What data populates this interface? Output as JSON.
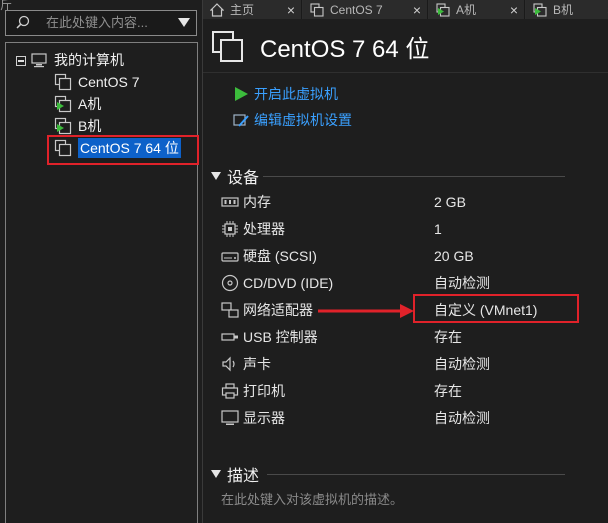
{
  "left_stub_text": "斤",
  "search": {
    "placeholder": "在此处键入内容...",
    "icon": "search-icon",
    "dropdown_icon": "triangle-down-icon"
  },
  "tree": {
    "root": {
      "label": "我的计算机",
      "icon": "computer-icon",
      "expanded": true
    },
    "items": [
      {
        "label": "CentOS 7",
        "icon": "vm-icon"
      },
      {
        "label": "A机",
        "icon": "vm-running-icon"
      },
      {
        "label": "B机",
        "icon": "vm-running-icon"
      },
      {
        "label": "CentOS 7 64 位",
        "icon": "vm-icon",
        "selected": true
      }
    ]
  },
  "tabs": [
    {
      "label": "主页",
      "icon": "home-icon",
      "close": "×"
    },
    {
      "label": "CentOS 7",
      "icon": "vm-icon",
      "close": "×"
    },
    {
      "label": "A机",
      "icon": "vm-running-icon",
      "close": "×"
    },
    {
      "label": "B机",
      "icon": "vm-running-icon",
      "close": "×"
    }
  ],
  "vm": {
    "title": "CentOS 7 64 位",
    "actions": [
      {
        "label": "开启此虚拟机",
        "icon": "play-icon"
      },
      {
        "label": "编辑虚拟机设置",
        "icon": "edit-settings-icon"
      }
    ]
  },
  "devices": {
    "heading": "设备",
    "rows": [
      {
        "name": "内存",
        "value": "2 GB",
        "icon": "memory-icon"
      },
      {
        "name": "处理器",
        "value": "1",
        "icon": "cpu-icon"
      },
      {
        "name": "硬盘 (SCSI)",
        "value": "20 GB",
        "icon": "harddisk-icon"
      },
      {
        "name": "CD/DVD (IDE)",
        "value": "自动检测",
        "icon": "cdrom-icon"
      },
      {
        "name": "网络适配器",
        "value": "自定义 (VMnet1)",
        "icon": "network-adapter-icon"
      },
      {
        "name": "USB 控制器",
        "value": "存在",
        "icon": "usb-icon"
      },
      {
        "name": "声卡",
        "value": "自动检测",
        "icon": "speaker-icon"
      },
      {
        "name": "打印机",
        "value": "存在",
        "icon": "printer-icon"
      },
      {
        "name": "显示器",
        "value": "自动检测",
        "icon": "monitor-icon"
      }
    ]
  },
  "description": {
    "heading": "描述",
    "placeholder": "在此处键入对该虚拟机的描述。"
  },
  "colors": {
    "accent_link": "#3aa0ff",
    "selection": "#0d61c9",
    "annotation_red": "#e0222a",
    "play_green": "#3cbc3c"
  }
}
